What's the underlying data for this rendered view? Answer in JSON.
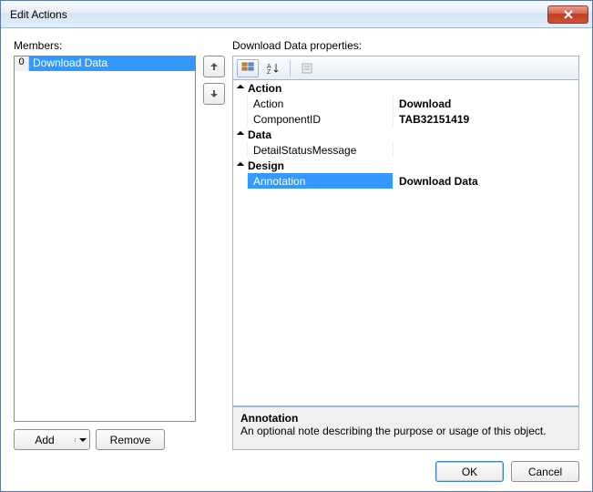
{
  "window": {
    "title": "Edit Actions"
  },
  "labels": {
    "members": "Members:",
    "properties": "Download Data properties:"
  },
  "members": [
    {
      "index": "0",
      "label": "Download Data",
      "selected": true
    }
  ],
  "buttons": {
    "add": "Add",
    "remove": "Remove",
    "ok": "OK",
    "cancel": "Cancel"
  },
  "properties": {
    "categories": [
      {
        "name": "Action",
        "rows": [
          {
            "name": "Action",
            "value": "Download"
          },
          {
            "name": "ComponentID",
            "value": "TAB32151419"
          }
        ]
      },
      {
        "name": "Data",
        "rows": [
          {
            "name": "DetailStatusMessage",
            "value": ""
          }
        ]
      },
      {
        "name": "Design",
        "rows": [
          {
            "name": "Annotation",
            "value": "Download Data",
            "selected": true
          }
        ]
      }
    ]
  },
  "description": {
    "title": "Annotation",
    "text": "An optional note describing the purpose or usage of this object."
  }
}
